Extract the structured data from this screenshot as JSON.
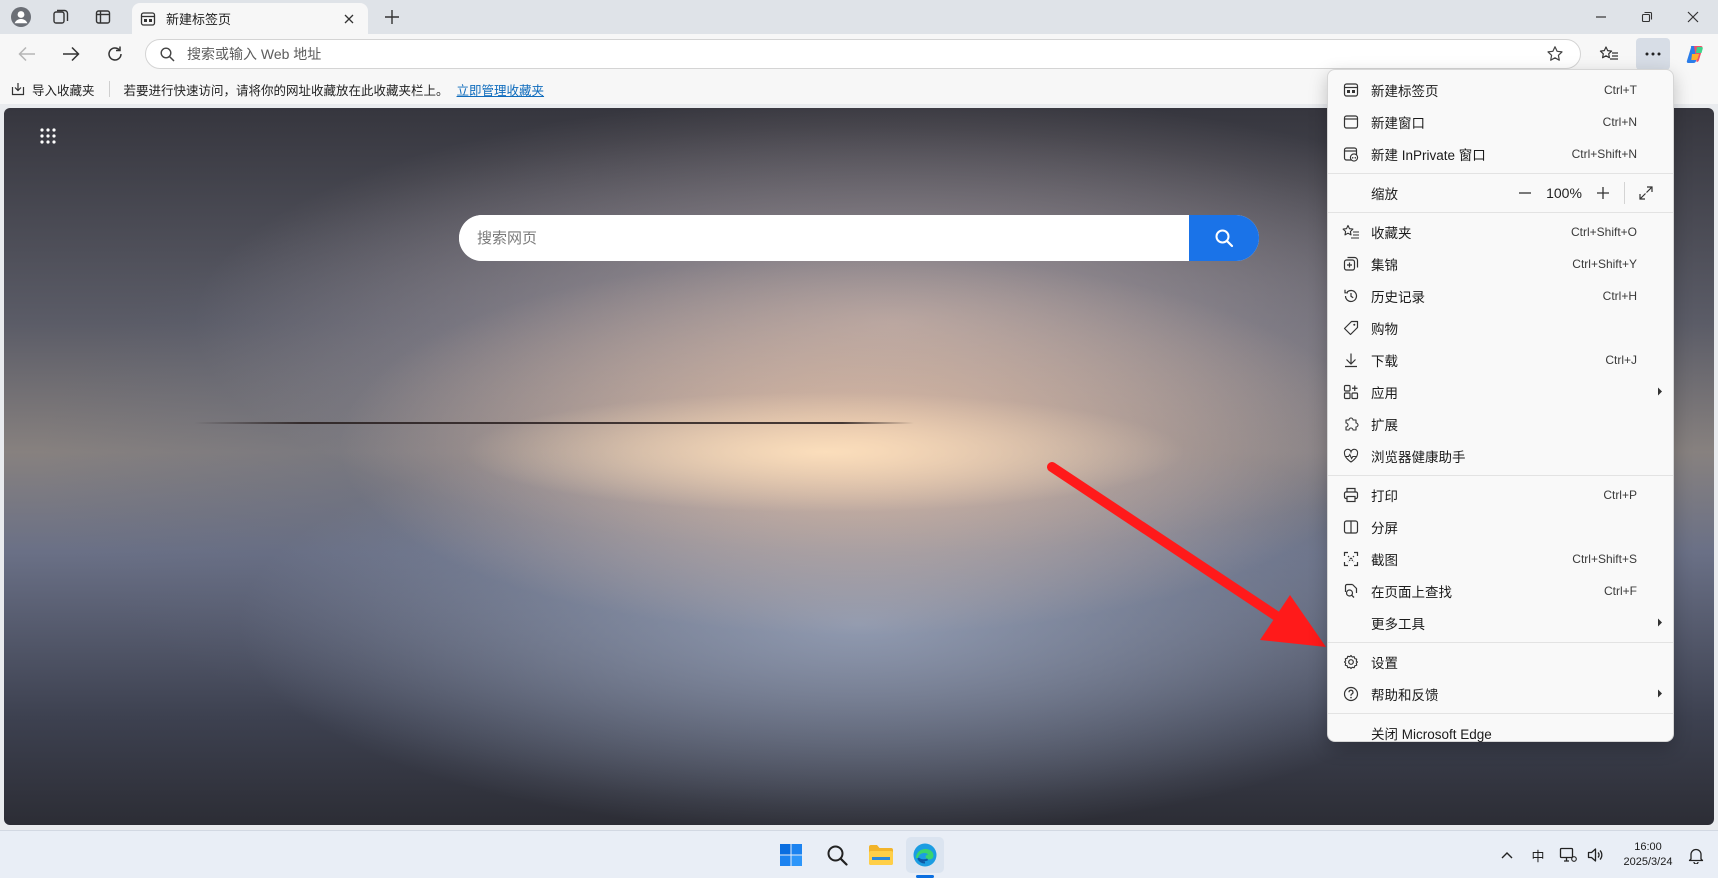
{
  "browser": {
    "tab": {
      "title": "新建标签页"
    },
    "address_bar": {
      "placeholder": "搜索或输入 Web 地址"
    },
    "favorites_bar": {
      "import_label": "导入收藏夹",
      "hint_text": "若要进行快速访问，请将你的网址收藏放在此收藏夹栏上。",
      "manage_link": "立即管理收藏夹"
    }
  },
  "page": {
    "search": {
      "placeholder": "搜索网页"
    }
  },
  "menu": {
    "items_top": [
      {
        "icon": "new-tab-icon",
        "label": "新建标签页",
        "shortcut": "Ctrl+T"
      },
      {
        "icon": "new-window-icon",
        "label": "新建窗口",
        "shortcut": "Ctrl+N"
      },
      {
        "icon": "inprivate-icon",
        "label": "新建 InPrivate 窗口",
        "shortcut": "Ctrl+Shift+N"
      }
    ],
    "zoom": {
      "label": "缩放",
      "value": "100%"
    },
    "items_middle": [
      {
        "icon": "favorites-icon",
        "label": "收藏夹",
        "shortcut": "Ctrl+Shift+O"
      },
      {
        "icon": "collections-icon",
        "label": "集锦",
        "shortcut": "Ctrl+Shift+Y"
      },
      {
        "icon": "history-icon",
        "label": "历史记录",
        "shortcut": "Ctrl+H"
      },
      {
        "icon": "shopping-tag-icon",
        "label": "购物",
        "shortcut": ""
      },
      {
        "icon": "download-icon",
        "label": "下载",
        "shortcut": "Ctrl+J"
      },
      {
        "icon": "apps-icon",
        "label": "应用",
        "shortcut": ""
      },
      {
        "icon": "extensions-icon",
        "label": "扩展",
        "shortcut": ""
      },
      {
        "icon": "browser-health-icon",
        "label": "浏览器健康助手",
        "shortcut": ""
      }
    ],
    "items_tools": [
      {
        "icon": "print-icon",
        "label": "打印",
        "shortcut": "Ctrl+P"
      },
      {
        "icon": "split-screen-icon",
        "label": "分屏",
        "shortcut": ""
      },
      {
        "icon": "screenshot-icon",
        "label": "截图",
        "shortcut": "Ctrl+Shift+S"
      },
      {
        "icon": "find-on-page-icon",
        "label": "在页面上查找",
        "shortcut": "Ctrl+F"
      },
      {
        "icon": "",
        "label": "更多工具",
        "shortcut": ""
      }
    ],
    "items_settings": [
      {
        "icon": "settings-gear-icon",
        "label": "设置",
        "shortcut": ""
      },
      {
        "icon": "help-icon",
        "label": "帮助和反馈",
        "shortcut": ""
      }
    ],
    "close_label": "关闭 Microsoft Edge"
  },
  "taskbar": {
    "ime": "中",
    "time": "16:00",
    "date": "2025/3/24"
  },
  "colors": {
    "accent": "#1a73e8",
    "annotation_arrow": "#ff1a1a",
    "link": "#0f6cbd"
  }
}
